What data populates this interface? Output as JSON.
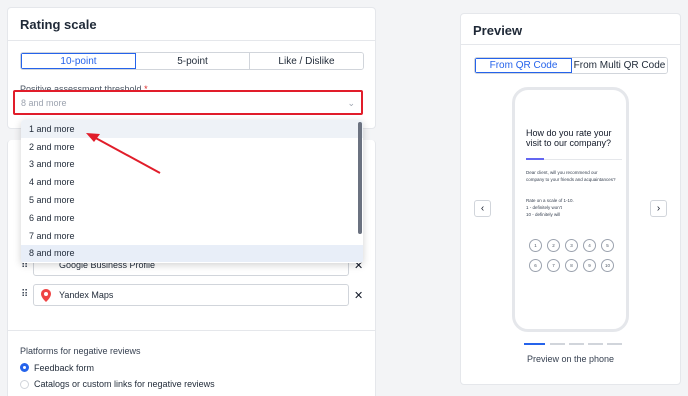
{
  "rating": {
    "title": "Rating scale",
    "scale_tabs": [
      "10-point",
      "5-point",
      "Like / Dislike"
    ],
    "threshold_label": "Positive assessment threshold",
    "required_mark": "*",
    "threshold_value": "8 and more",
    "options": [
      "1 and more",
      "2 and more",
      "3 and more",
      "4 and more",
      "5 and more",
      "6 and more",
      "7 and more",
      "8 and more"
    ]
  },
  "platforms": {
    "rows": [
      "Google Business Profile",
      "Yandex Maps"
    ],
    "negative_title": "Platforms for negative reviews",
    "negative_options": [
      "Feedback form",
      "Catalogs or custom links for negative reviews"
    ]
  },
  "preview": {
    "title": "Preview",
    "tabs": [
      "From QR Code",
      "From Multi QR Code"
    ],
    "caption": "Preview on the phone",
    "phone": {
      "question": "How do you rate your visit to our company?",
      "body1": "Dear client, will you recommend our company to your friends and acquaintances?",
      "body2": "Rate on a scale of 1-10.",
      "body3": "1 - definitely won't",
      "body4": "10 - definitely will",
      "numbers": [
        "1",
        "2",
        "3",
        "4",
        "5",
        "6",
        "7",
        "8",
        "9",
        "10"
      ]
    }
  },
  "colors": {
    "accent": "#2563eb",
    "highlight": "#e11d2a"
  }
}
